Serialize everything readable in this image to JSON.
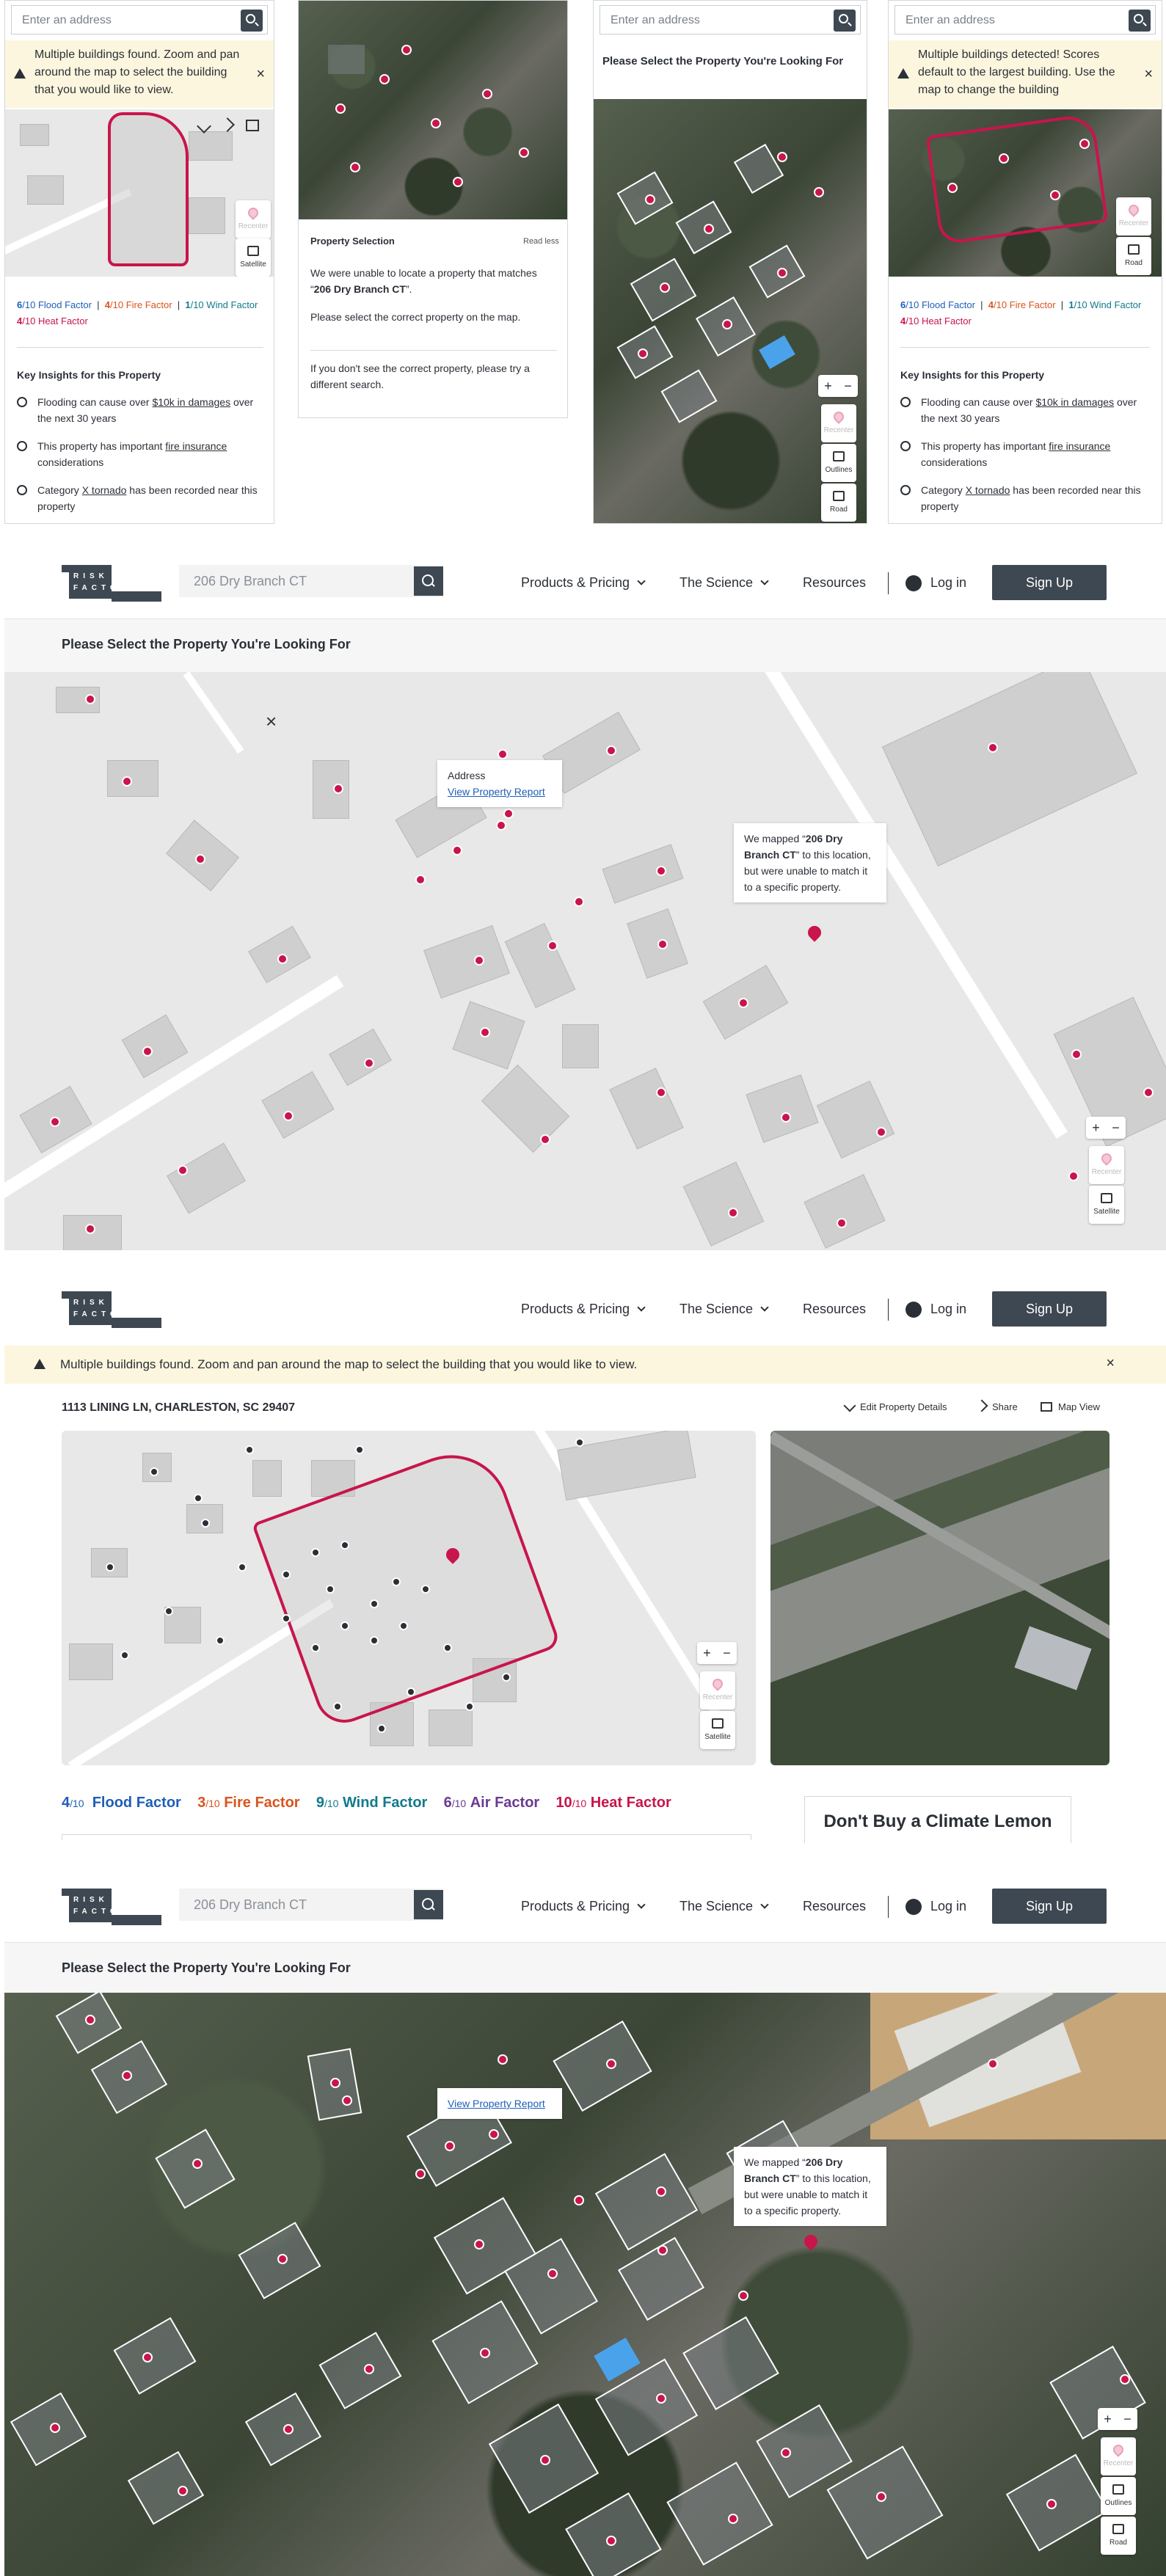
{
  "address_placeholder": "Enter an address",
  "panel1": {
    "warning": "Multiple buildings found. Zoom and pan around the map to select the building that you would like to view.",
    "satellite_label": "Satellite",
    "recenter_label": "Recenter"
  },
  "panel2": {
    "title": "Property Selection",
    "read_less": "Read less",
    "msg_prefix": "We were unable to locate a property that matches “",
    "msg_address": "206 Dry Branch CT",
    "msg_suffix": "”.",
    "msg2": "Please select the correct property on the map.",
    "msg3": "If you don't see the correct property, please try a different search."
  },
  "panel3": {
    "title": "Please Select the Property You're Looking For",
    "outlines_label": "Outlines",
    "road_label": "Road",
    "recenter_label": "Recenter"
  },
  "panel4": {
    "warning": "Multiple buildings detected! Scores default to the largest building. Use the map to change the building",
    "recenter_label": "Recenter",
    "road_label": "Road"
  },
  "factors": [
    {
      "score": "6",
      "denom": "/10",
      "label": "Flood Factor"
    },
    {
      "score": "4",
      "denom": "/10",
      "label": "Fire Factor"
    },
    {
      "score": "1",
      "denom": "/10",
      "label": "Wind Factor"
    },
    {
      "score": "4",
      "denom": "/10",
      "label": "Heat Factor"
    }
  ],
  "insights": {
    "title": "Key Insights for this Property",
    "i1_pre": "Flooding can cause over ",
    "i1_link": "$10k in damages",
    "i1_post": " over the next 30 years",
    "i2_pre": "This property has important ",
    "i2_link": "fire insurance",
    "i2_post": " considerations",
    "i3_pre": "Category ",
    "i3_link": "X tornado",
    "i3_post": " has been recorded near this property"
  },
  "nav": {
    "logo_text": "RISK FACTOR",
    "search_value": "206 Dry Branch CT",
    "products": "Products & Pricing",
    "science": "The Science",
    "resources": "Resources",
    "login": "Log in",
    "signup": "Sign Up"
  },
  "section2": {
    "subtitle": "Please Select the Property You're Looking For",
    "popup_address": "Address",
    "popup_link": "View Property Report",
    "tip_pre": "We mapped “",
    "tip_addr": "206 Dry Branch CT",
    "tip_post": "” to this location, but were unable to match it to a specific property.",
    "recenter": "Recenter",
    "satellite": "Satellite"
  },
  "section3": {
    "warning": "Multiple buildings found. Zoom and pan around the map to select the building that you would like to view.",
    "address": "1113 LINING LN, CHARLESTON, SC 29407",
    "edit": "Edit Property Details",
    "share": "Share",
    "mapview": "Map View",
    "lemon": "Don't Buy a Climate Lemon",
    "factors": [
      {
        "score": "4",
        "denom": "/10",
        "label": "Flood Factor"
      },
      {
        "score": "3",
        "denom": "/10",
        "label": "Fire Factor"
      },
      {
        "score": "9",
        "denom": "/10",
        "label": "Wind Factor"
      },
      {
        "score": "6",
        "denom": "/10",
        "label": "Air Factor"
      },
      {
        "score": "10",
        "denom": "/10",
        "label": "Heat Factor"
      }
    ]
  },
  "section4": {
    "subtitle": "Please Select the Property You're Looking For",
    "popup_link": "View Property Report",
    "outlines": "Outlines",
    "road": "Road",
    "recenter": "Recenter"
  }
}
